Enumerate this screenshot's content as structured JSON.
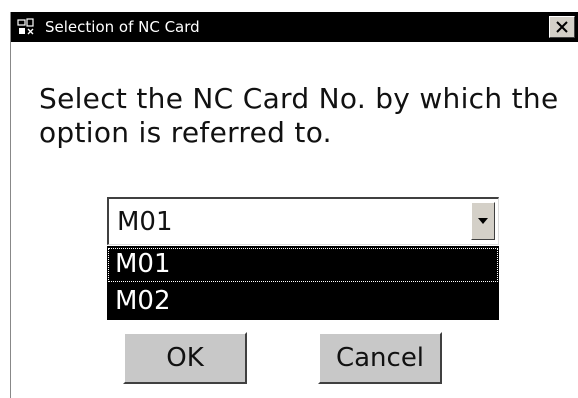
{
  "dialog": {
    "title": "Selection of NC Card",
    "message": "Select the NC Card No. by which the option is referred to."
  },
  "combo": {
    "selected": "M01",
    "options": [
      "M01",
      "M02"
    ]
  },
  "buttons": {
    "ok_label": "OK",
    "cancel_label": "Cancel"
  },
  "icons": {
    "title_icon": "app-icon",
    "close_icon": "close-icon",
    "dropdown_icon": "chevron-down-icon"
  }
}
